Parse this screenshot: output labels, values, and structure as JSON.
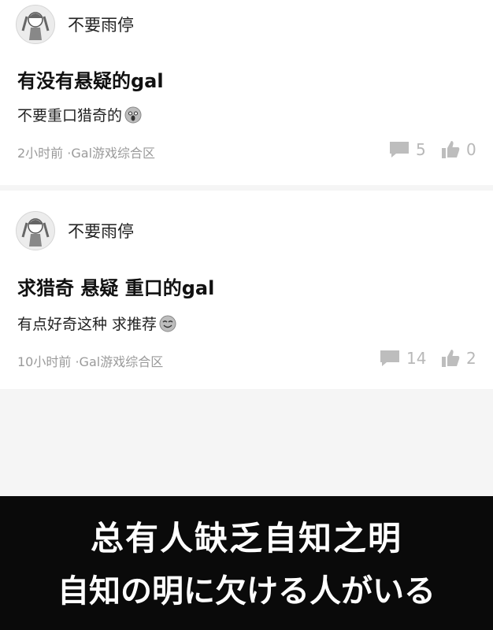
{
  "posts": [
    {
      "username": "不要雨停",
      "title": "有没有悬疑的gal",
      "body": "不要重口猎奇的",
      "time": "2小时前",
      "category": "·Gal游戏综合区",
      "comments": "5",
      "likes": "0",
      "emoji": "screaming-face-icon"
    },
    {
      "username": "不要雨停",
      "title": "求猎奇 悬疑 重口的gal",
      "body": "有点好奇这种 求推荐",
      "time": "10小时前",
      "category": "·Gal游戏综合区",
      "comments": "14",
      "likes": "2",
      "emoji": "smiling-face-icon"
    }
  ],
  "subtitle": {
    "zh": "总有人缺乏自知之明",
    "ja": "自知の明に欠ける人がいる"
  }
}
